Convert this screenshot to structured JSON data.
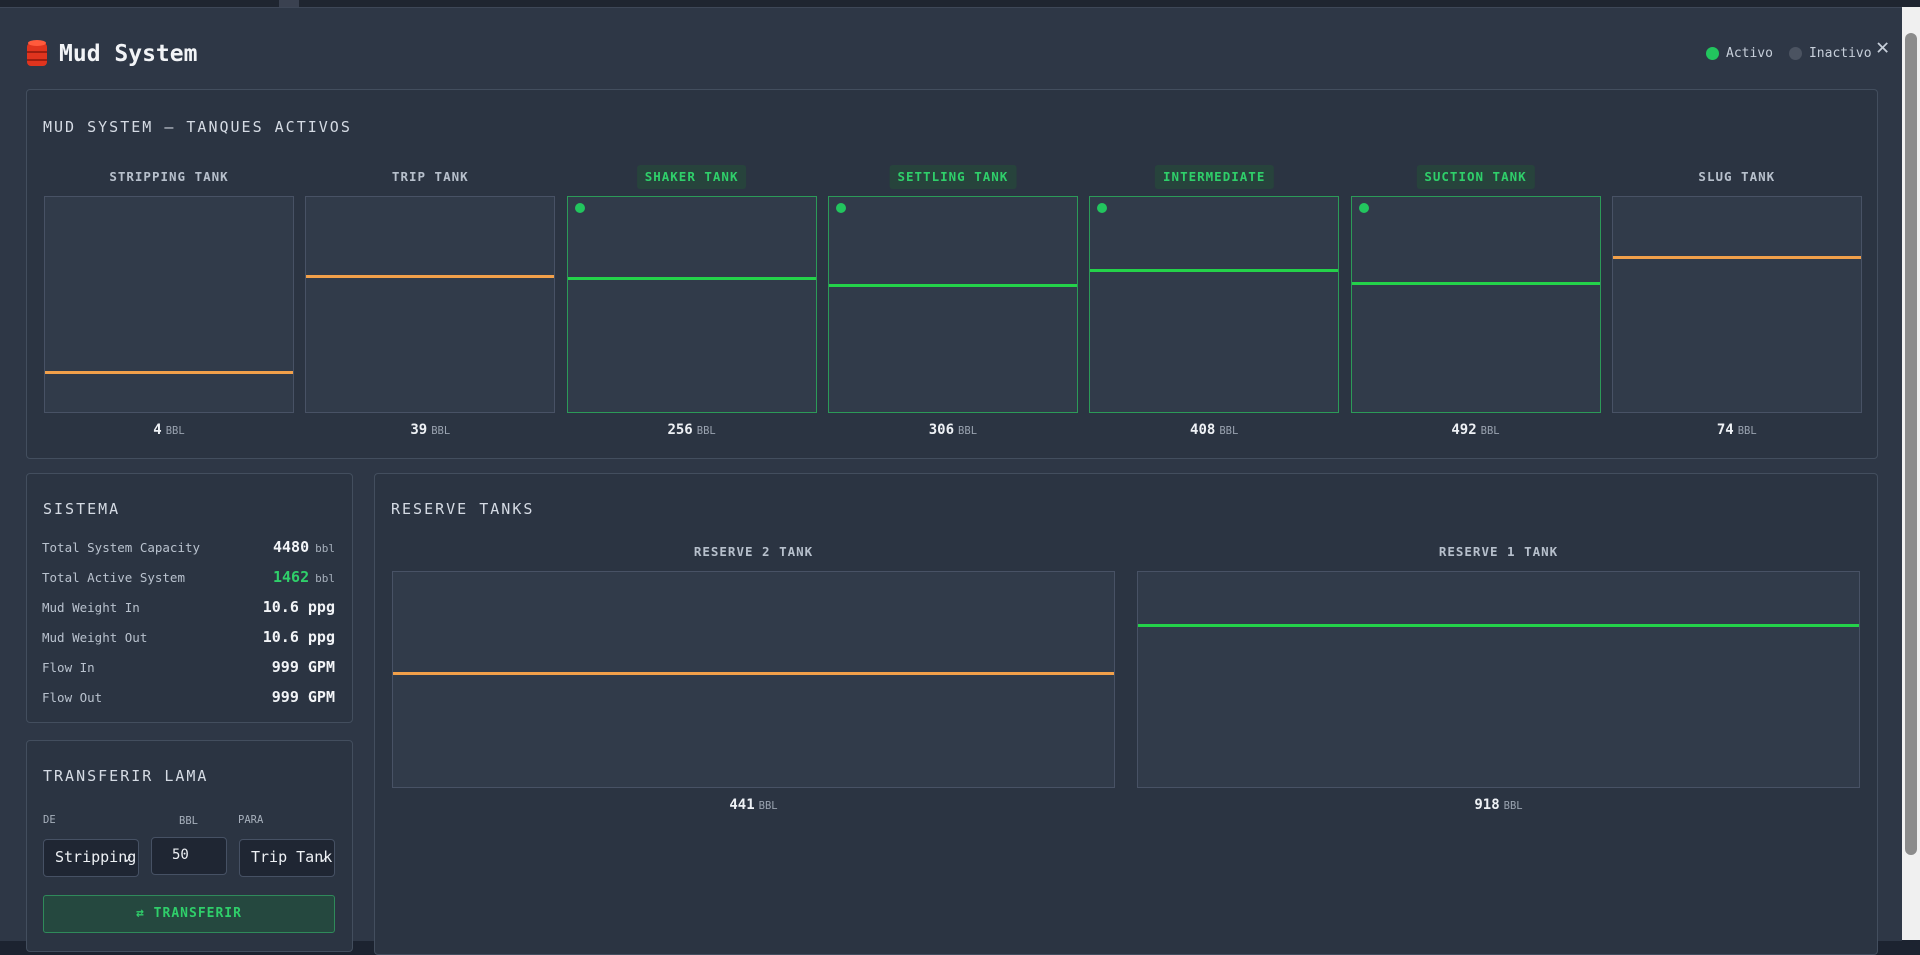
{
  "app": {
    "title": "Mud System"
  },
  "legend": {
    "active": "Activo",
    "inactive": "Inactivo"
  },
  "active_tanks": {
    "title": "MUD SYSTEM — TANQUES ACTIVOS",
    "unit": "BBL",
    "tanks": [
      {
        "label": "STRIPPING TANK",
        "value": "4",
        "active": false,
        "level": 0.2,
        "color": "orange"
      },
      {
        "label": "TRIP TANK",
        "value": "39",
        "active": false,
        "level": 0.64,
        "color": "orange"
      },
      {
        "label": "SHAKER TANK",
        "value": "256",
        "active": true,
        "level": 0.63,
        "color": "green"
      },
      {
        "label": "SETTLING TANK",
        "value": "306",
        "active": true,
        "level": 0.6,
        "color": "green"
      },
      {
        "label": "INTERMEDIATE",
        "value": "408",
        "active": true,
        "level": 0.67,
        "color": "green"
      },
      {
        "label": "SUCTION TANK",
        "value": "492",
        "active": true,
        "level": 0.61,
        "color": "green"
      },
      {
        "label": "SLUG TANK",
        "value": "74",
        "active": false,
        "level": 0.73,
        "color": "orange"
      }
    ]
  },
  "sistema": {
    "title": "SISTEMA",
    "rows": [
      {
        "label": "Total System Capacity",
        "value": "4480",
        "unit": "bbl",
        "highlight": false
      },
      {
        "label": "Total Active System",
        "value": "1462",
        "unit": "bbl",
        "highlight": true
      },
      {
        "label": "Mud Weight In",
        "value": "10.6 ppg",
        "unit": "",
        "highlight": false
      },
      {
        "label": "Mud Weight Out",
        "value": "10.6 ppg",
        "unit": "",
        "highlight": false
      },
      {
        "label": "Flow In",
        "value": "999 GPM",
        "unit": "",
        "highlight": false
      },
      {
        "label": "Flow Out",
        "value": "999 GPM",
        "unit": "",
        "highlight": false
      }
    ]
  },
  "transfer": {
    "title": "TRANSFERIR LAMA",
    "from_label": "DE",
    "amount_label": "BBL",
    "to_label": "PARA",
    "from_value": "Stripping",
    "amount_value": "50",
    "to_value": "Trip Tank",
    "button_label": "⇄ TRANSFERIR"
  },
  "reserve": {
    "title": "RESERVE TANKS",
    "unit": "BBL",
    "tanks": [
      {
        "label": "RESERVE 2 TANK",
        "value": "441",
        "level": 0.54,
        "color": "orange"
      },
      {
        "label": "RESERVE 1 TANK",
        "value": "918",
        "level": 0.76,
        "color": "green"
      }
    ]
  },
  "colors": {
    "active": "#22c55e",
    "orange_level": "#f2a04a",
    "green_level": "#24d24a",
    "background": "#2e3746"
  }
}
